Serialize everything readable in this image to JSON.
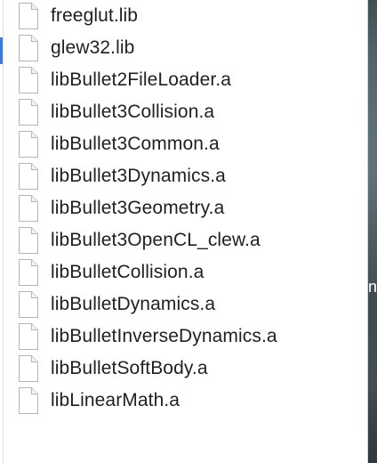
{
  "files": [
    {
      "name": "freeglut.lib",
      "icon": "file-document-icon"
    },
    {
      "name": "glew32.lib",
      "icon": "file-document-icon"
    },
    {
      "name": "libBullet2FileLoader.a",
      "icon": "file-document-icon"
    },
    {
      "name": "libBullet3Collision.a",
      "icon": "file-document-icon"
    },
    {
      "name": "libBullet3Common.a",
      "icon": "file-document-icon"
    },
    {
      "name": "libBullet3Dynamics.a",
      "icon": "file-document-icon"
    },
    {
      "name": "libBullet3Geometry.a",
      "icon": "file-document-icon"
    },
    {
      "name": "libBullet3OpenCL_clew.a",
      "icon": "file-document-icon"
    },
    {
      "name": "libBulletCollision.a",
      "icon": "file-document-icon"
    },
    {
      "name": "libBulletDynamics.a",
      "icon": "file-document-icon"
    },
    {
      "name": "libBulletInverseDynamics.a",
      "icon": "file-document-icon"
    },
    {
      "name": "libBulletSoftBody.a",
      "icon": "file-document-icon"
    },
    {
      "name": "libLinearMath.a",
      "icon": "file-document-icon"
    }
  ],
  "background": {
    "glyph": "n"
  },
  "colors": {
    "selection_accent": "#2f7cf6",
    "text": "#1f1f1f",
    "panel_bg": "#ffffff"
  }
}
